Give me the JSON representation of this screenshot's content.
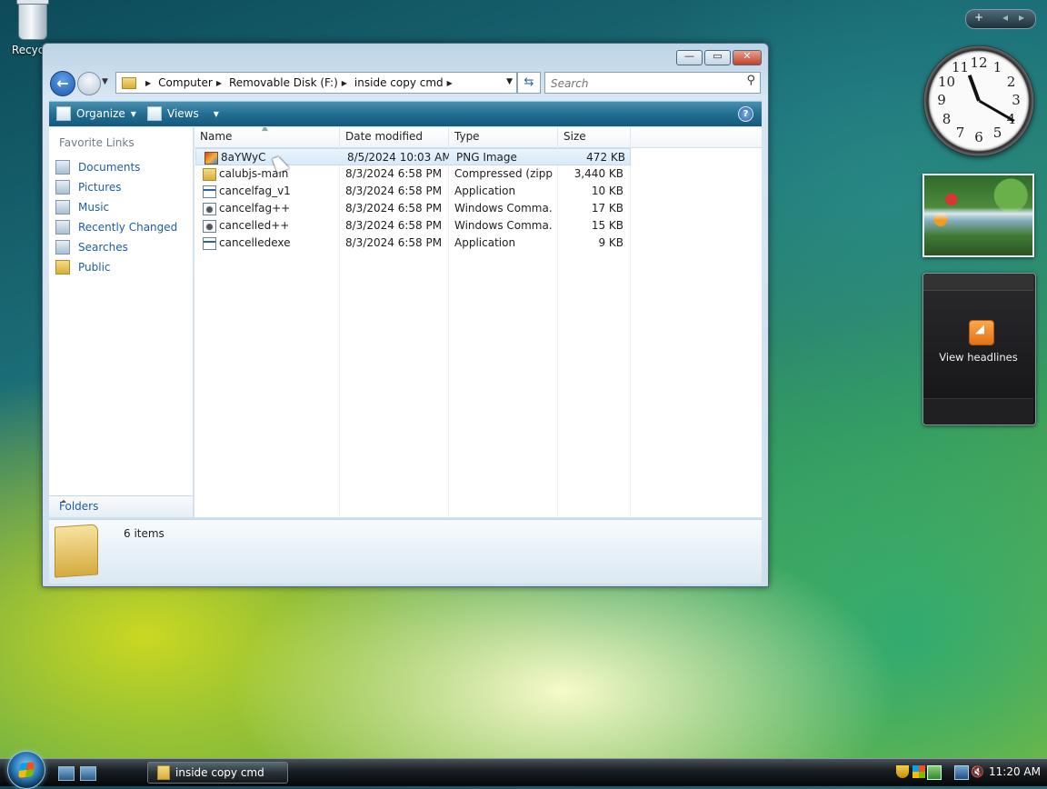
{
  "desktop": {
    "recycle_bin_label": "Recycle"
  },
  "window": {
    "minimize_glyph": "—",
    "maximize_glyph": "▭",
    "close_glyph": "✕",
    "address": {
      "crumbs": [
        "Computer",
        "Removable Disk (F:)",
        "inside copy cmd"
      ]
    },
    "search": {
      "placeholder": "Search"
    },
    "toolbar": {
      "organize_label": "Organize",
      "views_label": "Views",
      "help_glyph": "?"
    },
    "left_pane": {
      "title": "Favorite Links",
      "items": [
        {
          "label": "Documents",
          "icon": "documents-icon"
        },
        {
          "label": "Pictures",
          "icon": "pictures-icon"
        },
        {
          "label": "Music",
          "icon": "music-icon"
        },
        {
          "label": "Recently Changed",
          "icon": "recently-changed-icon"
        },
        {
          "label": "Searches",
          "icon": "searches-icon"
        },
        {
          "label": "Public",
          "icon": "public-folder-icon"
        }
      ],
      "folders_label": "Folders"
    },
    "file_list": {
      "columns": [
        "Name",
        "Date modified",
        "Type",
        "Size"
      ],
      "rows": [
        {
          "name": "8aYWyC",
          "date": "8/5/2024 10:03 AM",
          "type": "PNG Image",
          "size": "472 KB",
          "icon": "png-image-icon",
          "selected": true
        },
        {
          "name": "calubjs-main",
          "date": "8/3/2024 6:58 PM",
          "type": "Compressed (zipp...",
          "size": "3,440 KB",
          "icon": "zip-folder-icon",
          "selected": false
        },
        {
          "name": "cancelfag_v1",
          "date": "8/3/2024 6:58 PM",
          "type": "Application",
          "size": "10 KB",
          "icon": "application-icon",
          "selected": false
        },
        {
          "name": "cancelfag++",
          "date": "8/3/2024 6:58 PM",
          "type": "Windows Comma...",
          "size": "17 KB",
          "icon": "command-script-icon",
          "selected": false
        },
        {
          "name": "cancelled++",
          "date": "8/3/2024 6:58 PM",
          "type": "Windows Comma...",
          "size": "15 KB",
          "icon": "command-script-icon",
          "selected": false
        },
        {
          "name": "cancelledexe",
          "date": "8/3/2024 6:58 PM",
          "type": "Application",
          "size": "9 KB",
          "icon": "application-icon",
          "selected": false
        }
      ]
    },
    "details": {
      "item_count": "6 items"
    }
  },
  "gadgets": {
    "control_plus": "+",
    "control_prev": "◂",
    "control_next": "▸",
    "clock_numbers": [
      "12",
      "1",
      "2",
      "3",
      "4",
      "5",
      "6",
      "7",
      "8",
      "9",
      "10",
      "11"
    ],
    "feeds_label": "View headlines"
  },
  "taskbar": {
    "window_button_label": "inside copy cmd",
    "clock": "11:20 AM"
  }
}
